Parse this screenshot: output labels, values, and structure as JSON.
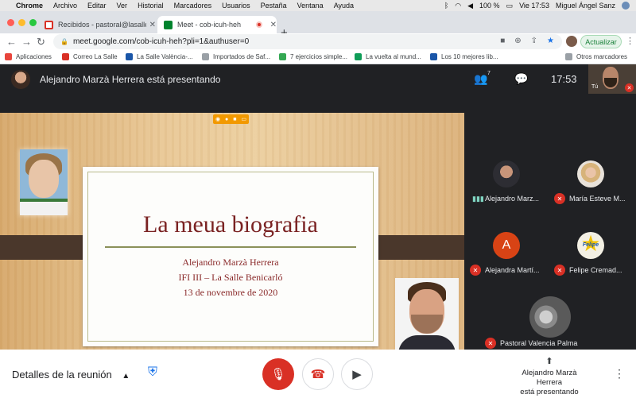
{
  "mac_menubar": {
    "apple": "",
    "items": [
      "Chrome",
      "Archivo",
      "Editar",
      "Ver",
      "Historial",
      "Marcadores",
      "Usuarios",
      "Pestaña",
      "Ventana",
      "Ayuda"
    ],
    "battery": "100 %",
    "datetime": "Vie 17:53",
    "user": "Miguel Ángel Sanz"
  },
  "tabs": [
    {
      "title": "Recibidos - pastoral@lasallevp",
      "favicon": "gmail-icon",
      "color": "#d93025"
    },
    {
      "title": "Meet - cob-icuh-heh",
      "favicon": "meet-icon",
      "color": "#00832d"
    }
  ],
  "address_bar": {
    "url": "meet.google.com/cob-icuh-heh?pli=1&authuser=0",
    "update_label": "Actualizar"
  },
  "bookmarks": [
    {
      "label": "Aplicaciones",
      "color": "#e8453c"
    },
    {
      "label": "Correo La Salle",
      "color": "#d93025"
    },
    {
      "label": "La Salle València-...",
      "color": "#1a56a8"
    },
    {
      "label": "Importados de Saf...",
      "color": "#5f6368"
    },
    {
      "label": "7 ejercicios simple...",
      "color": "#34a853"
    },
    {
      "label": "La vuelta al mund...",
      "color": "#0f9d58"
    },
    {
      "label": "Los 10 mejores lib...",
      "color": "#1a56a8"
    },
    {
      "label": "Otros marcadores",
      "color": "#5f6368"
    }
  ],
  "meet": {
    "presenting_banner": "Alejandro Marzà Herrera está presentando",
    "participant_count": "7",
    "clock": "17:53",
    "self_label": "Tú",
    "slide": {
      "title": "La meua biografia",
      "author": "Alejandro Marzà Herrera",
      "course": "IFI III – La Salle Benicarló",
      "date": "13 de novembre de 2020"
    },
    "participants": [
      {
        "name": "Alejandro Marz...",
        "status": "speaking"
      },
      {
        "name": "María Esteve M...",
        "status": "muted"
      },
      {
        "name": "Alejandra Martí...",
        "status": "muted",
        "initial": "A"
      },
      {
        "name": "Felipe Cremad...",
        "status": "muted",
        "logo_text": "Felipe"
      },
      {
        "name": "Pastoral Valencia Palma",
        "status": "muted"
      }
    ],
    "bottom": {
      "details_label": "Detalles de la reunión",
      "present_line1": "Alejandro Marzà Herrera",
      "present_line2": "está presentando"
    }
  }
}
